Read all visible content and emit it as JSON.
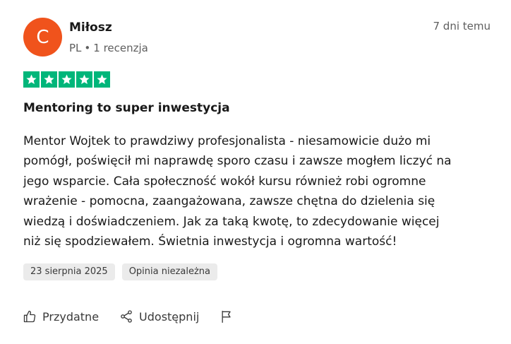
{
  "reviewer": {
    "avatar_initial": "C",
    "avatar_color": "#f0531c",
    "name": "Miłosz",
    "country": "PL",
    "separator": "•",
    "review_count": "1 recenzja"
  },
  "date_ago": "7 dni temu",
  "rating": {
    "stars": 5,
    "max": 5,
    "star_color": "#00b67a"
  },
  "review": {
    "title": "Mentoring to super inwestycja",
    "lines": [
      "Mentor Wojtek to prawdziwy profesjonalista - niesamowicie dużo mi",
      "pomógł, poświęcił mi naprawdę sporo czasu i zawsze mogłem liczyć na",
      "jego wsparcie. Cała społeczność wokół kursu również robi ogromne",
      "wrażenie - pomocna, zaangażowana, zawsze chętna do dzielenia się",
      "wiedzą i doświadczeniem. Jak za taką kwotę, to zdecydowanie więcej",
      "niż się spodziewałem. Świetnia inwestycja i ogromna wartość!"
    ]
  },
  "chips": {
    "date": "23 sierpnia 2025",
    "label": "Opinia niezależna"
  },
  "actions": {
    "helpful_label": "Przydatne",
    "helpful_icon": "thumbs-up-icon",
    "share_label": "Udostępnij",
    "share_icon": "share-icon",
    "report_icon": "flag-icon"
  }
}
